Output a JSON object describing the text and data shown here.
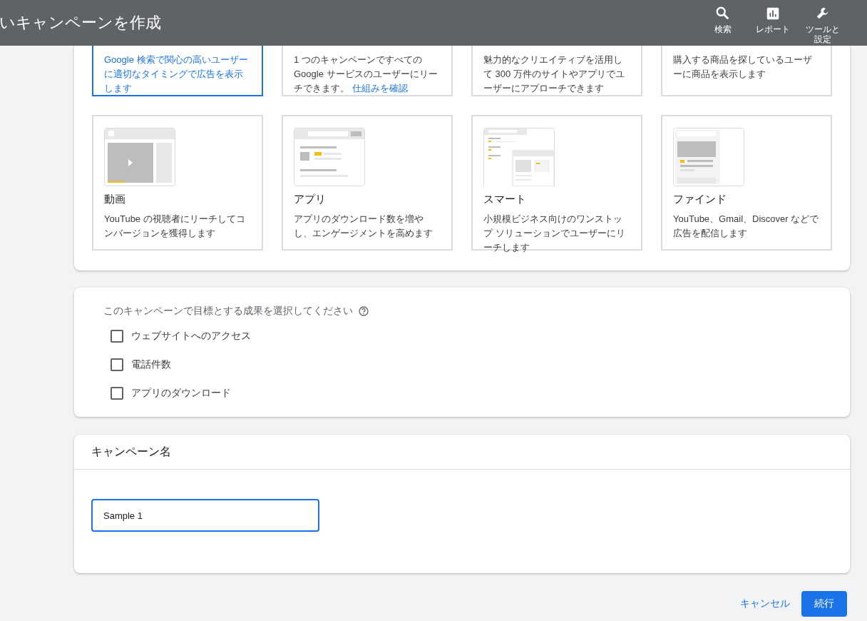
{
  "header": {
    "title": "いキャンペーンを作成",
    "actions": [
      {
        "kind": "search",
        "label": "検索"
      },
      {
        "kind": "report",
        "label": "レポート"
      },
      {
        "kind": "tools",
        "label": "ツールと設定"
      }
    ]
  },
  "campaign_types": [
    {
      "description": "Google 検索で関心の高いユーザーに適切なタイミングで広告を表示します",
      "selected": true
    },
    {
      "description": "1 つのキャンペーンですべての Google サービスのユーザーにリーチできます。",
      "link": "仕組みを確認",
      "selected": false
    },
    {
      "description": "魅力的なクリエイティブを活用して 300 万件のサイトやアプリでユーザーにアプローチできます",
      "selected": false
    },
    {
      "description": "購入する商品を探しているユーザーに商品を表示します",
      "selected": false
    },
    {
      "kind": "video",
      "title": "動画",
      "description": "YouTube の視聴者にリーチしてコンバージョンを獲得します",
      "selected": false
    },
    {
      "kind": "app",
      "title": "アプリ",
      "description": "アプリのダウンロード数を増やし、エンゲージメントを高めます",
      "selected": false
    },
    {
      "kind": "smart",
      "title": "スマート",
      "description": "小規模ビジネス向けのワンストップ ソリューションでユーザーにリーチします",
      "selected": false
    },
    {
      "kind": "discovery",
      "title": "ファインド",
      "description": "YouTube、Gmail、Discover などで広告を配信します",
      "selected": false
    }
  ],
  "goals": {
    "question": "このキャンペーンで目標とする成果を選択してください",
    "options": [
      {
        "label": "ウェブサイトへのアクセス",
        "checked": false
      },
      {
        "label": "電話件数",
        "checked": false
      },
      {
        "label": "アプリのダウンロード",
        "checked": false
      }
    ]
  },
  "campaign_name": {
    "heading": "キャンペーン名",
    "value": "Sample 1"
  },
  "footer": {
    "cancel": "キャンセル",
    "continue": "続行"
  }
}
